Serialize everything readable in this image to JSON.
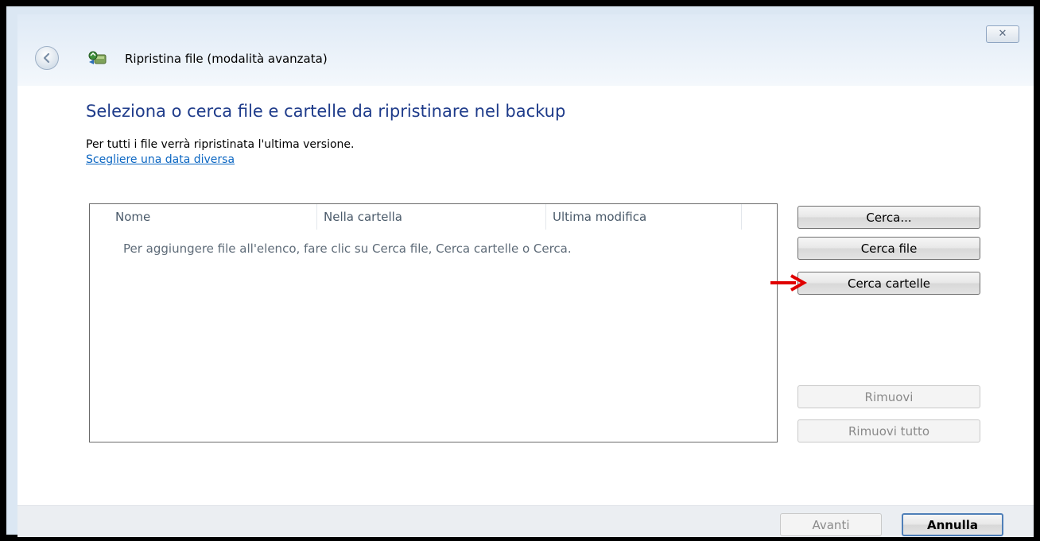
{
  "window": {
    "title": "Ripristina file (modalità avanzata)",
    "close_icon": "close-icon"
  },
  "content": {
    "heading": "Seleziona o cerca file e cartelle da ripristinare nel backup",
    "info": "Per tutti i file verrà ripristinata l'ultima versione.",
    "date_link": "Scegliere una data diversa"
  },
  "list": {
    "columns": [
      "Nome",
      "Nella cartella",
      "Ultima modifica"
    ],
    "empty_message": "Per aggiungere file all'elenco, fare clic su Cerca file, Cerca cartelle o Cerca."
  },
  "side_buttons": {
    "cerca": "Cerca...",
    "cerca_file": "Cerca file",
    "cerca_cartelle": "Cerca cartelle",
    "rimuovi": "Rimuovi",
    "rimuovi_tutto": "Rimuovi tutto"
  },
  "footer": {
    "avanti": "Avanti",
    "annulla": "Annulla"
  },
  "colors": {
    "heading": "#1e3b8a",
    "link": "#0b66c2",
    "annotation_arrow": "#e00000"
  }
}
